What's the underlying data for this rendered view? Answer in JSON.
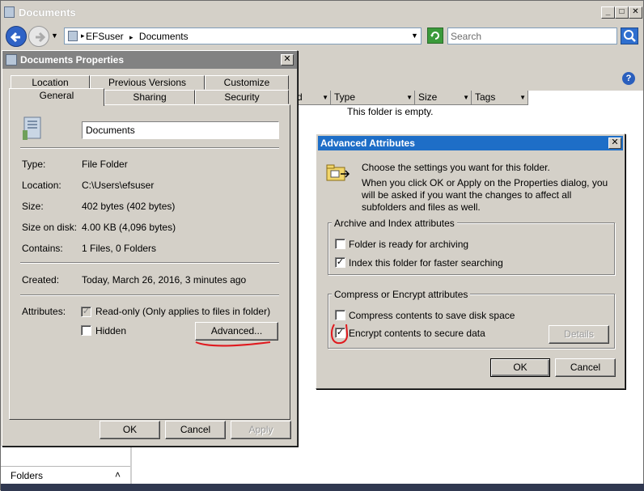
{
  "explorer": {
    "title": "Documents",
    "breadcrumb": [
      "EFSuser",
      "Documents"
    ],
    "search_placeholder": "Search",
    "columns": [
      "d",
      "Type",
      "Size",
      "Tags"
    ],
    "empty_message": "This folder is empty.",
    "folders_label": "Folders"
  },
  "properties": {
    "title": "Documents Properties",
    "tabs_row1": [
      "Location",
      "Previous Versions",
      "Customize"
    ],
    "tabs_row2": [
      "General",
      "Sharing",
      "Security"
    ],
    "active_tab": "General",
    "name_value": "Documents",
    "fields": [
      {
        "label": "Type:",
        "value": "File Folder"
      },
      {
        "label": "Location:",
        "value": "C:\\Users\\efsuser"
      },
      {
        "label": "Size:",
        "value": "402 bytes (402 bytes)"
      },
      {
        "label": "Size on disk:",
        "value": "4.00 KB (4,096 bytes)"
      },
      {
        "label": "Contains:",
        "value": "1 Files, 0 Folders"
      }
    ],
    "created_label": "Created:",
    "created_value": "Today, March 26, 2016, 3 minutes ago",
    "attributes_label": "Attributes:",
    "readonly_label": "Read-only (Only applies to files in folder)",
    "readonly_checked": true,
    "hidden_label": "Hidden",
    "hidden_checked": false,
    "advanced_button": "Advanced...",
    "ok": "OK",
    "cancel": "Cancel",
    "apply": "Apply"
  },
  "advanced": {
    "title": "Advanced Attributes",
    "intro_line1": "Choose the settings you want for this folder.",
    "intro_line2": "When you click OK or Apply on the Properties dialog, you will be asked if you want the changes to affect all subfolders and files as well.",
    "archive_group": "Archive and Index attributes",
    "archive_label": "Folder is ready for archiving",
    "archive_checked": false,
    "index_label": "Index this folder for faster searching",
    "index_checked": true,
    "compress_group": "Compress or Encrypt attributes",
    "compress_label": "Compress contents to save disk space",
    "compress_checked": false,
    "encrypt_label": "Encrypt contents to secure data",
    "encrypt_checked": true,
    "details_button": "Details",
    "ok": "OK",
    "cancel": "Cancel"
  },
  "colors": {
    "dialog_face": "#d4d0c8",
    "active_title": "#1e6ec7",
    "inactive_title": "#828282",
    "annotation_red": "#e0191e"
  }
}
